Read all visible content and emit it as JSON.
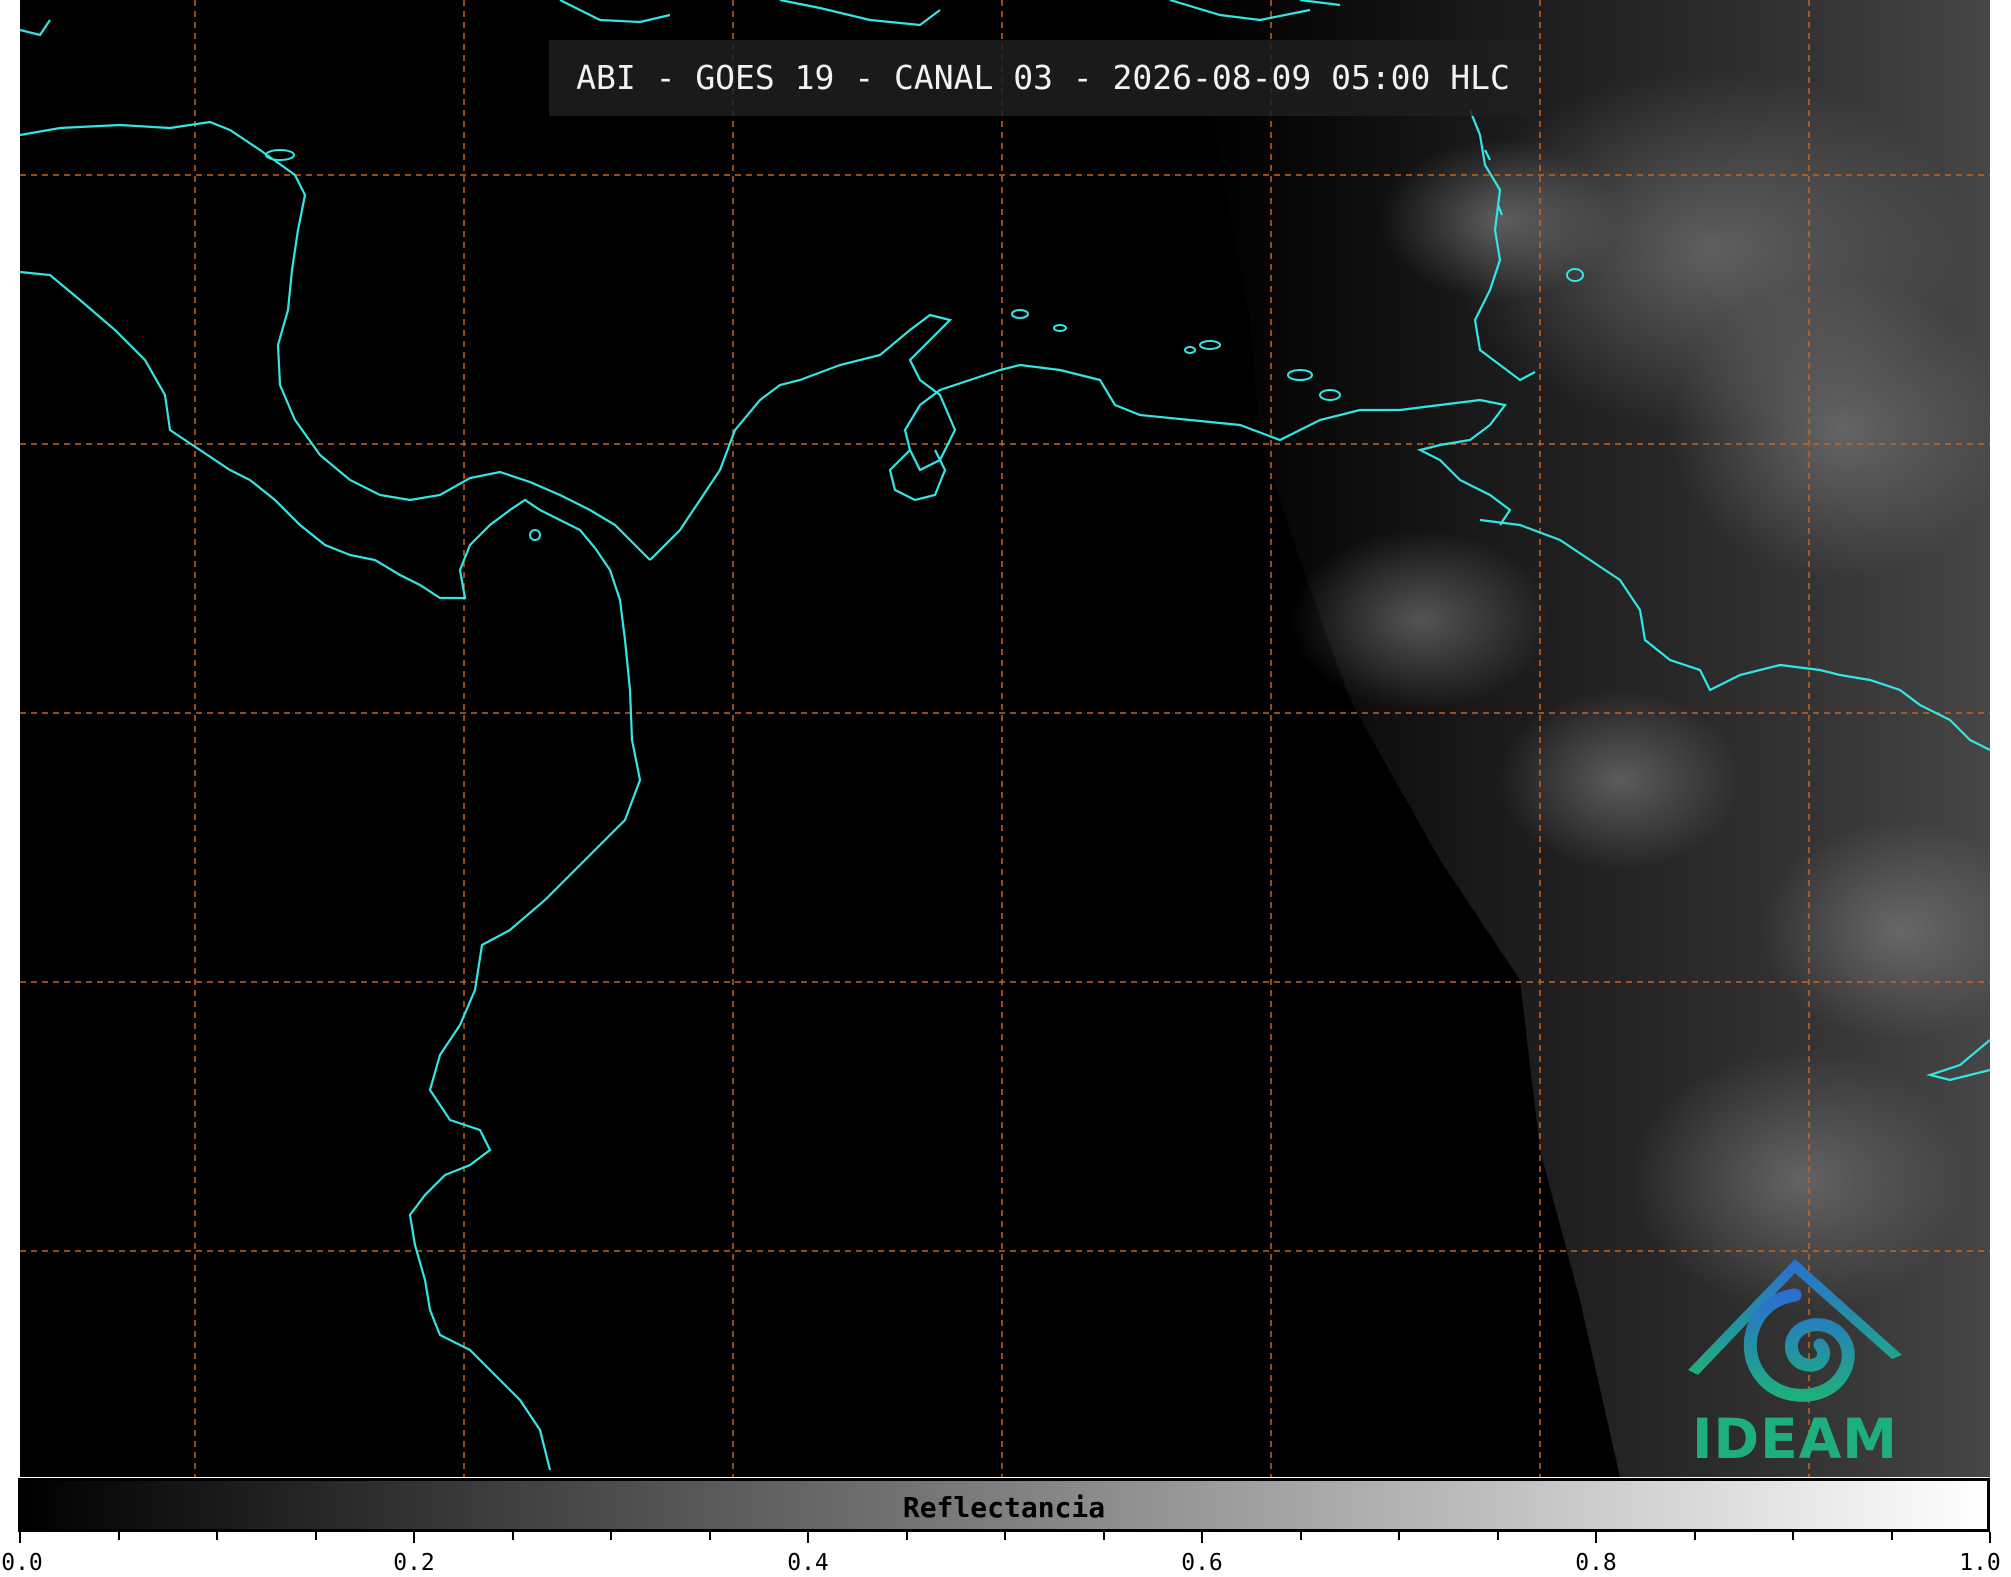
{
  "map": {
    "title": "ABI - GOES 19 - CANAL 03 - 2026-08-09 05:00 HLC",
    "colors": {
      "background": "#000000",
      "coastline": "#33e6e6",
      "gridlines": "#c8641e",
      "clouds": "#9a9a9a"
    }
  },
  "colorbar": {
    "label": "Reflectancia",
    "range": [
      0.0,
      1.0
    ],
    "ticks": [
      "0.0",
      "0.2",
      "0.4",
      "0.6",
      "0.8",
      "1.0"
    ],
    "colormap": "grayscale"
  },
  "logo": {
    "text": "IDEAM",
    "colors": {
      "top": "#2a6fd0",
      "bottom": "#1fae7e"
    }
  }
}
